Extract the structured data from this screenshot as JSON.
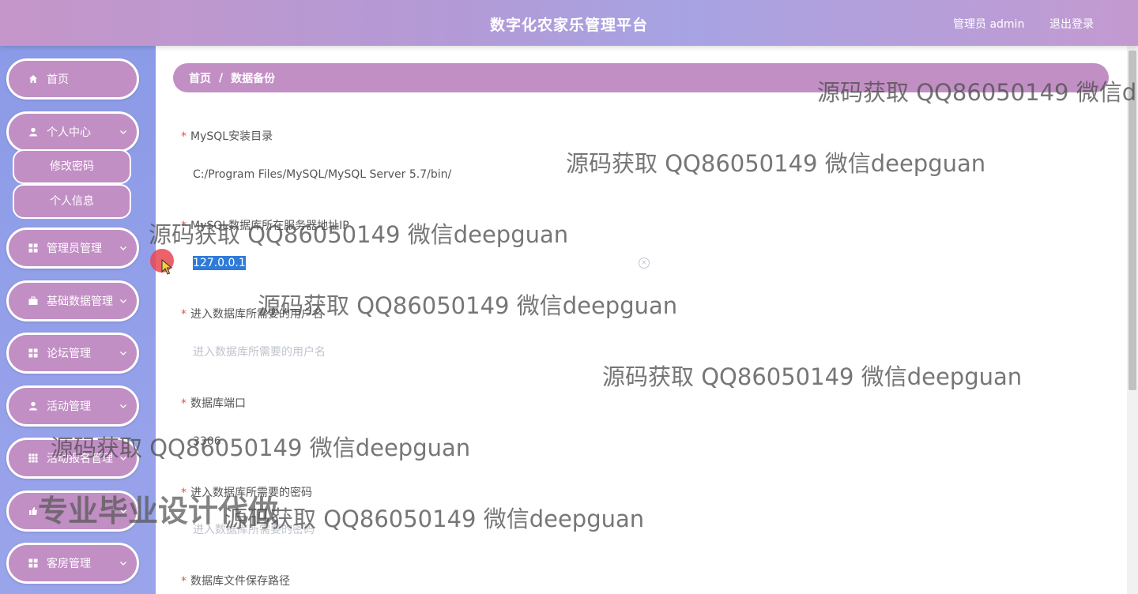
{
  "header": {
    "title": "数字化农家乐管理平台",
    "user_label": "管理员 admin",
    "logout_label": "退出登录"
  },
  "sidebar": {
    "items": [
      {
        "label": "首页",
        "icon": "home-icon"
      },
      {
        "label": "个人中心",
        "icon": "user-icon"
      },
      {
        "label": "管理员管理",
        "icon": "grid-icon"
      },
      {
        "label": "基础数据管理",
        "icon": "briefcase-icon"
      },
      {
        "label": "论坛管理",
        "icon": "grid-icon"
      },
      {
        "label": "活动管理",
        "icon": "user-icon"
      },
      {
        "label": "活动报名管理",
        "icon": "apps-icon"
      },
      {
        "label": "",
        "icon": "thumb-icon"
      },
      {
        "label": "客房管理",
        "icon": "grid-icon"
      }
    ],
    "submenu": [
      {
        "label": "修改密码"
      },
      {
        "label": "个人信息"
      }
    ]
  },
  "breadcrumb": {
    "home": "首页",
    "separator": "/",
    "current": "数据备份"
  },
  "form": {
    "mysql_dir": {
      "label": "MySQL安装目录",
      "value": "C:/Program Files/MySQL/MySQL Server 5.7/bin/"
    },
    "server_ip": {
      "label": "MySQL数据库所在服务器地址IP",
      "value": "127.0.0.1"
    },
    "db_user": {
      "label": "进入数据库所需要的用户名",
      "placeholder": "进入数据库所需要的用户名"
    },
    "db_port": {
      "label": "数据库端口",
      "value": "3306"
    },
    "db_password": {
      "label": "进入数据库所需要的密码",
      "placeholder": "进入数据库所需要的密码"
    },
    "save_path": {
      "label": "数据库文件保存路径"
    }
  },
  "watermarks": {
    "text": "源码获取 QQ86050149 微信deepguan",
    "text_cut1": "源码获取 QQ86050149 微信deep",
    "text_cut2": "源码获取 QQ86050149 微信d",
    "big": "专业毕业设计代做"
  },
  "colors": {
    "accent": "#c28fc4",
    "sidebar": "#8c9be8",
    "required": "#e0534a",
    "selection": "#2f7bd9"
  }
}
